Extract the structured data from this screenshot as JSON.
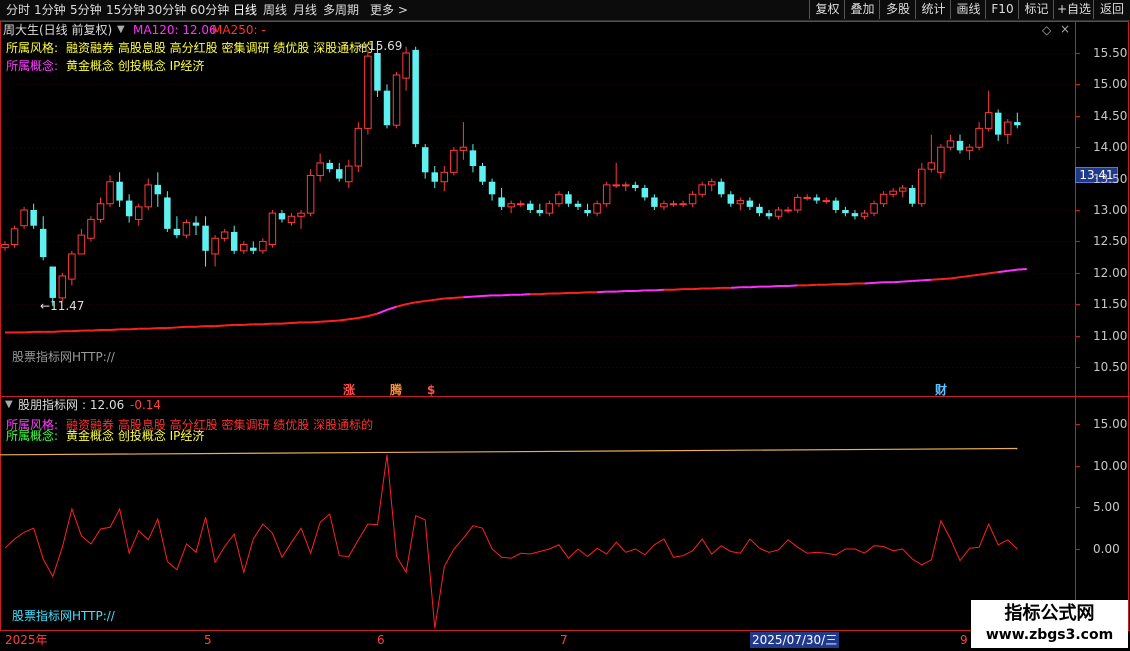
{
  "toolbar": {
    "periods": [
      "分时",
      "1分钟",
      "5分钟",
      "15分钟",
      "30分钟",
      "60分钟",
      "日线",
      "周线",
      "月线",
      "多周期",
      "更多 >"
    ],
    "active_period": "日线",
    "buttons": [
      "复权",
      "叠加",
      "多股",
      "统计",
      "画线",
      "F10",
      "标记",
      "+自选",
      "返回"
    ]
  },
  "main_panel": {
    "title": "周大生(日线 前复权)",
    "ma120_label": "MA120: 12.06",
    "ma250_label": "MA250: -",
    "style_label": "所属风格:",
    "style_value": "融资融券 高股息股 高分红股 密集调研 绩优股 深股通标的",
    "concept_label": "所属概念:",
    "concept_value": "黄金概念 创投概念 IP经济",
    "high_label": "15.69",
    "low_label": "11.47",
    "current_price": "13.41",
    "watermark": "股票指标网HTTP://",
    "markers": [
      "涨",
      "腾",
      "$",
      "财"
    ]
  },
  "sub_panel": {
    "title": "股朋指标网",
    "value": ": 12.06",
    "change": "-0.14",
    "style_label": "所属风格:",
    "style_value": "融资融券 高股息股 高分红股 密集调研 绩优股 深股通标的",
    "concept_label": "所属概念:",
    "concept_value": "黄金概念 创投概念 IP经济",
    "watermark": "股票指标网HTTP://"
  },
  "time_axis": {
    "labels": [
      "2025年",
      "5",
      "6",
      "7",
      "9"
    ],
    "cursor_date": "2025/07/30/三"
  },
  "site_watermark": {
    "title": "指标公式网",
    "url": "www.zbgs3.com"
  },
  "colors": {
    "up": "#ff3a3a",
    "down": "#5ff0f0",
    "ma_red": "#ff2020",
    "ma_magenta": "#ff30ff",
    "sub_line": "#ff2020",
    "sub_ma": "#e8b050",
    "grid": "#8b1a1a",
    "frame": "#c81e1e"
  },
  "chart_data": [
    {
      "type": "candlestick",
      "title": "周大生(日线 前复权)",
      "ylim": [
        10.3,
        15.9
      ],
      "y_ticks": [
        "15.50",
        "15.00",
        "14.50",
        "14.00",
        "13.50",
        "13.00",
        "12.50",
        "12.00",
        "11.50",
        "11.00",
        "10.50"
      ],
      "ma120": [
        11.05,
        11.05,
        11.05,
        11.06,
        11.06,
        11.06,
        11.07,
        11.07,
        11.08,
        11.08,
        11.09,
        11.09,
        11.1,
        11.1,
        11.11,
        11.11,
        11.12,
        11.12,
        11.13,
        11.14,
        11.14,
        11.15,
        11.15,
        11.16,
        11.17,
        11.17,
        11.18,
        11.18,
        11.19,
        11.19,
        11.2,
        11.21,
        11.21,
        11.22,
        11.23,
        11.24,
        11.26,
        11.28,
        11.31,
        11.35,
        11.41,
        11.46,
        11.5,
        11.53,
        11.55,
        11.57,
        11.59,
        11.6,
        11.61,
        11.62,
        11.63,
        11.64,
        11.64,
        11.65,
        11.65,
        11.66,
        11.66,
        11.67,
        11.67,
        11.68,
        11.68,
        11.69,
        11.69,
        11.7,
        11.7,
        11.71,
        11.71,
        11.72,
        11.72,
        11.73,
        11.73,
        11.74,
        11.74,
        11.75,
        11.75,
        11.76,
        11.76,
        11.77,
        11.77,
        11.78,
        11.78,
        11.79,
        11.79,
        11.8,
        11.8,
        11.81,
        11.81,
        11.82,
        11.82,
        11.83,
        11.83,
        11.84,
        11.85,
        11.85,
        11.86,
        11.87,
        11.88,
        11.89,
        11.9,
        11.91,
        11.93,
        11.95,
        11.97,
        11.99,
        12.01,
        12.03,
        12.05,
        12.06
      ],
      "candles": [
        [
          12.4,
          12.5,
          12.35,
          12.45
        ],
        [
          12.45,
          12.75,
          12.4,
          12.7
        ],
        [
          12.75,
          13.05,
          12.7,
          13.0
        ],
        [
          13.0,
          13.1,
          12.7,
          12.75
        ],
        [
          12.7,
          12.9,
          12.2,
          12.25
        ],
        [
          12.1,
          12.1,
          11.47,
          11.6
        ],
        [
          11.6,
          12.0,
          11.55,
          11.95
        ],
        [
          11.9,
          12.35,
          11.8,
          12.3
        ],
        [
          12.3,
          12.7,
          12.3,
          12.6
        ],
        [
          12.55,
          12.9,
          12.5,
          12.85
        ],
        [
          12.85,
          13.2,
          12.8,
          13.1
        ],
        [
          13.1,
          13.55,
          13.05,
          13.45
        ],
        [
          13.45,
          13.6,
          13.05,
          13.15
        ],
        [
          13.15,
          13.25,
          12.8,
          12.9
        ],
        [
          12.85,
          13.1,
          12.75,
          13.05
        ],
        [
          13.05,
          13.5,
          13.0,
          13.4
        ],
        [
          13.4,
          13.6,
          13.05,
          13.25
        ],
        [
          13.2,
          13.3,
          12.65,
          12.7
        ],
        [
          12.7,
          12.9,
          12.55,
          12.6
        ],
        [
          12.6,
          12.85,
          12.55,
          12.8
        ],
        [
          12.8,
          12.9,
          12.6,
          12.75
        ],
        [
          12.75,
          12.9,
          12.1,
          12.35
        ],
        [
          12.3,
          12.6,
          12.1,
          12.55
        ],
        [
          12.55,
          12.7,
          12.5,
          12.65
        ],
        [
          12.65,
          12.75,
          12.3,
          12.35
        ],
        [
          12.35,
          12.5,
          12.3,
          12.45
        ],
        [
          12.4,
          12.5,
          12.3,
          12.35
        ],
        [
          12.35,
          12.55,
          12.3,
          12.5
        ],
        [
          12.45,
          13.0,
          12.4,
          12.95
        ],
        [
          12.95,
          13.0,
          12.8,
          12.85
        ],
        [
          12.8,
          12.95,
          12.75,
          12.9
        ],
        [
          12.9,
          13.0,
          12.7,
          12.95
        ],
        [
          12.95,
          13.65,
          12.9,
          13.55
        ],
        [
          13.55,
          13.9,
          13.45,
          13.75
        ],
        [
          13.75,
          13.8,
          13.6,
          13.65
        ],
        [
          13.65,
          13.75,
          13.45,
          13.5
        ],
        [
          13.45,
          13.8,
          13.35,
          13.7
        ],
        [
          13.7,
          14.4,
          13.6,
          14.3
        ],
        [
          14.3,
          15.55,
          14.2,
          15.45
        ],
        [
          15.5,
          15.69,
          14.8,
          14.9
        ],
        [
          14.9,
          15.0,
          14.3,
          14.35
        ],
        [
          14.35,
          15.2,
          14.3,
          15.15
        ],
        [
          15.1,
          15.6,
          14.9,
          15.5
        ],
        [
          15.55,
          15.6,
          14.0,
          14.05
        ],
        [
          14.0,
          14.05,
          13.5,
          13.6
        ],
        [
          13.6,
          13.7,
          13.35,
          13.45
        ],
        [
          13.45,
          13.7,
          13.3,
          13.6
        ],
        [
          13.6,
          14.0,
          13.55,
          13.95
        ],
        [
          13.95,
          14.4,
          13.8,
          14.0
        ],
        [
          13.95,
          14.05,
          13.6,
          13.7
        ],
        [
          13.7,
          13.75,
          13.4,
          13.45
        ],
        [
          13.45,
          13.5,
          13.15,
          13.25
        ],
        [
          13.2,
          13.35,
          13.0,
          13.05
        ],
        [
          13.05,
          13.15,
          12.95,
          13.1
        ],
        [
          13.1,
          13.15,
          13.05,
          13.1
        ],
        [
          13.1,
          13.15,
          12.95,
          13.0
        ],
        [
          13.0,
          13.1,
          12.9,
          12.95
        ],
        [
          12.95,
          13.15,
          12.9,
          13.1
        ],
        [
          13.1,
          13.3,
          13.05,
          13.25
        ],
        [
          13.25,
          13.3,
          13.05,
          13.1
        ],
        [
          13.1,
          13.15,
          13.0,
          13.05
        ],
        [
          13.0,
          13.1,
          12.9,
          12.95
        ],
        [
          12.95,
          13.15,
          12.9,
          13.1
        ],
        [
          13.1,
          13.45,
          13.05,
          13.4
        ],
        [
          13.4,
          13.75,
          13.35,
          13.4
        ],
        [
          13.4,
          13.45,
          13.3,
          13.4
        ],
        [
          13.4,
          13.45,
          13.3,
          13.35
        ],
        [
          13.35,
          13.4,
          13.15,
          13.2
        ],
        [
          13.2,
          13.25,
          13.0,
          13.05
        ],
        [
          13.05,
          13.15,
          13.0,
          13.1
        ],
        [
          13.1,
          13.15,
          13.05,
          13.1
        ],
        [
          13.1,
          13.15,
          13.05,
          13.1
        ],
        [
          13.1,
          13.3,
          13.05,
          13.25
        ],
        [
          13.25,
          13.45,
          13.2,
          13.4
        ],
        [
          13.4,
          13.5,
          13.3,
          13.45
        ],
        [
          13.45,
          13.5,
          13.2,
          13.25
        ],
        [
          13.25,
          13.3,
          13.05,
          13.1
        ],
        [
          13.1,
          13.2,
          13.0,
          13.15
        ],
        [
          13.15,
          13.2,
          13.0,
          13.05
        ],
        [
          13.05,
          13.1,
          12.9,
          12.95
        ],
        [
          12.95,
          13.0,
          12.85,
          12.9
        ],
        [
          12.9,
          13.05,
          12.85,
          13.0
        ],
        [
          13.0,
          13.05,
          12.95,
          13.0
        ],
        [
          13.0,
          13.25,
          12.95,
          13.2
        ],
        [
          13.2,
          13.25,
          13.15,
          13.2
        ],
        [
          13.2,
          13.25,
          13.1,
          13.15
        ],
        [
          13.15,
          13.2,
          13.1,
          13.15
        ],
        [
          13.15,
          13.2,
          12.95,
          13.0
        ],
        [
          13.0,
          13.05,
          12.9,
          12.95
        ],
        [
          12.95,
          13.0,
          12.85,
          12.9
        ],
        [
          12.9,
          13.0,
          12.85,
          12.95
        ],
        [
          12.95,
          13.15,
          12.9,
          13.1
        ],
        [
          13.1,
          13.3,
          13.05,
          13.25
        ],
        [
          13.25,
          13.35,
          13.2,
          13.3
        ],
        [
          13.3,
          13.4,
          13.2,
          13.35
        ],
        [
          13.35,
          13.4,
          13.05,
          13.1
        ],
        [
          13.1,
          13.75,
          13.05,
          13.65
        ],
        [
          13.65,
          14.2,
          13.6,
          13.75
        ],
        [
          13.6,
          14.05,
          13.5,
          14.0
        ],
        [
          14.0,
          14.2,
          13.95,
          14.1
        ],
        [
          14.1,
          14.2,
          13.9,
          13.95
        ],
        [
          13.95,
          14.05,
          13.8,
          14.0
        ],
        [
          14.0,
          14.4,
          13.95,
          14.3
        ],
        [
          14.3,
          14.9,
          14.25,
          14.55
        ],
        [
          14.55,
          14.6,
          14.1,
          14.2
        ],
        [
          14.2,
          14.45,
          14.05,
          14.4
        ],
        [
          14.4,
          14.55,
          14.3,
          14.35
        ]
      ]
    },
    {
      "type": "line",
      "title": "股朋指标网",
      "ylim": [
        -7.5,
        17.5
      ],
      "y_ticks": [
        "15.00",
        "10.00",
        "5.00",
        "0.00"
      ],
      "series": [
        {
          "values": [
            0.1,
            1.2,
            2.0,
            2.5,
            -1.2,
            -3.3,
            0.2,
            4.8,
            1.6,
            0.6,
            2.4,
            2.6,
            4.8,
            -0.5,
            2.2,
            1.1,
            3.6,
            -1.5,
            -2.5,
            0.6,
            -0.4,
            3.8,
            -1.6,
            0.3,
            1.8,
            -2.8,
            1.2,
            3.0,
            1.9,
            -1.0,
            0.8,
            2.5,
            -0.5,
            3.2,
            4.2,
            -0.8,
            -0.9,
            1.1,
            3.0,
            2.9,
            11.3,
            -0.9,
            -2.8,
            4.0,
            3.5,
            -9.5,
            -2.1,
            0.0,
            1.3,
            2.8,
            2.5,
            0.0,
            -1.0,
            -1.1,
            -0.5,
            -0.6,
            -0.3,
            0.0,
            0.5,
            -1.1,
            0.0,
            -0.9,
            0.1,
            -0.6,
            0.8,
            -0.4,
            0.0,
            -0.7,
            0.5,
            1.2,
            -1.0,
            -0.8,
            -0.2,
            1.2,
            -0.6,
            0.4,
            -0.3,
            -0.5,
            1.2,
            0.1,
            -0.4,
            -0.1,
            1.1,
            0.2,
            -0.5,
            -0.4,
            -0.5,
            -0.7,
            0.0,
            0.0,
            -0.5,
            0.4,
            0.3,
            -0.2,
            0.0,
            -1.2,
            -1.9,
            -1.3,
            3.4,
            1.2,
            -1.4,
            0.1,
            0.2,
            3.0,
            0.5,
            1.1,
            0.0
          ]
        },
        {
          "values": [
            11.3,
            12.06
          ]
        }
      ]
    }
  ]
}
